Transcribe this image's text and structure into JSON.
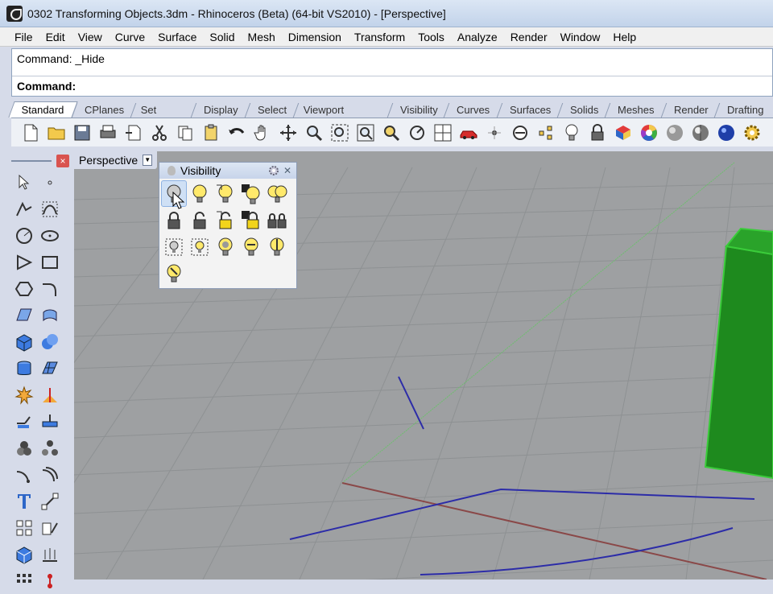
{
  "window": {
    "title": "0302 Transforming Objects.3dm - Rhinoceros (Beta) (64-bit VS2010) - [Perspective]"
  },
  "menu": [
    "File",
    "Edit",
    "View",
    "Curve",
    "Surface",
    "Solid",
    "Mesh",
    "Dimension",
    "Transform",
    "Tools",
    "Analyze",
    "Render",
    "Window",
    "Help"
  ],
  "command": {
    "history": "Command: _Hide",
    "prompt": "Command:"
  },
  "toolbar_tabs": [
    "Standard",
    "CPlanes",
    "Set View",
    "Display",
    "Select",
    "Viewport Layout",
    "Visibility",
    "Curves",
    "Surfaces",
    "Solids",
    "Meshes",
    "Render",
    "Drafting"
  ],
  "active_tab": "Standard",
  "toolbar_icons": [
    "new-file-icon",
    "open-icon",
    "save-icon",
    "print-icon",
    "import-icon",
    "cut-icon",
    "copy-icon",
    "paste-icon",
    "undo-icon",
    "pan-hand-icon",
    "rotate-view-icon",
    "zoom-icon",
    "zoom-window-icon",
    "zoom-extents-icon",
    "zoom-selected-icon",
    "named-view-icon",
    "viewport-layout-icon",
    "car-icon",
    "object-snap-icon",
    "cplane-icon",
    "points-icon",
    "light-bulb-icon",
    "lock-icon",
    "render-icon",
    "color-wheel-icon",
    "shaded-icon",
    "rendered-icon",
    "sphere-icon",
    "settings-icon"
  ],
  "viewport": {
    "label": "Perspective"
  },
  "visibility_panel": {
    "title": "Visibility"
  },
  "colors": {
    "viewport_bg": "#9ea0a2",
    "grid_line": "#8e9193",
    "x_axis": "#8a4848",
    "y_axis": "#6dbf6d",
    "box_green": "#1e8a1e",
    "curve": "#2c2ca8",
    "title_bar": "#c8d7ec"
  }
}
